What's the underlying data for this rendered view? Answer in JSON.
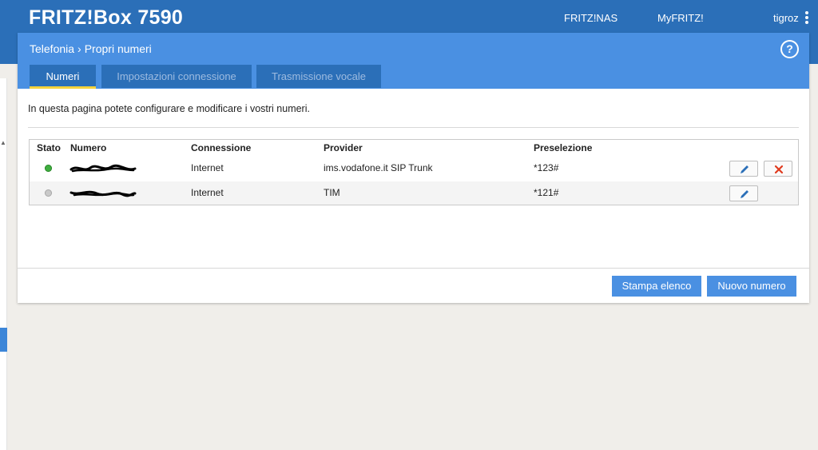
{
  "header": {
    "brand": "FRITZ!Box 7590",
    "nav": [
      "FRITZ!NAS",
      "MyFRITZ!",
      "tigroz"
    ],
    "menu_icon": "vertical-dots-icon"
  },
  "breadcrumb": {
    "section": "Telefonia",
    "page": "Propri numeri"
  },
  "help_icon": "?",
  "tabs": [
    {
      "label": "Numeri",
      "active": true
    },
    {
      "label": "Impostazioni connessione",
      "active": false
    },
    {
      "label": "Trasmissione vocale",
      "active": false
    }
  ],
  "intro": "In questa pagina potete configurare e modificare i vostri numeri.",
  "table": {
    "columns": [
      "Stato",
      "Numero",
      "Connessione",
      "Provider",
      "Preselezione"
    ],
    "rows": [
      {
        "status": "online",
        "connection": "Internet",
        "provider": "ims.vodafone.it SIP Trunk",
        "preselection": "*123#",
        "actions": [
          "edit",
          "delete"
        ]
      },
      {
        "status": "offline",
        "connection": "Internet",
        "provider": "TIM",
        "preselection": "*121#",
        "actions": [
          "edit"
        ]
      }
    ]
  },
  "buttons": {
    "print": "Stampa elenco",
    "new": "Nuovo numero"
  },
  "colors": {
    "header": "#2b6fb8",
    "panel_head": "#4a90e2",
    "tab_underline": "#f5d33c",
    "status_on": "#3fae3f",
    "delete": "#e03a1e"
  }
}
